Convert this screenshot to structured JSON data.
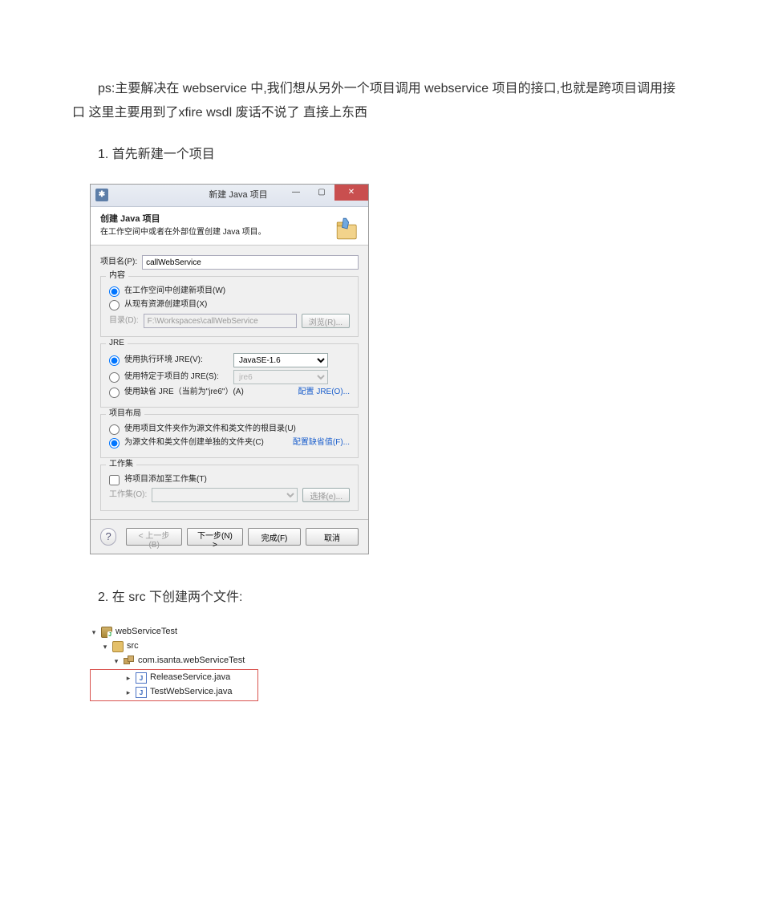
{
  "doc": {
    "para1": "ps:主要解决在 webservice 中,我们想从另外一个项目调用 webservice 项目的接口,也就是跨项目调用接口 这里主要用到了xfire wsdl 废话不说了 直接上东西",
    "step1": "1. 首先新建一个项目",
    "step2": "2. 在 src 下创建两个文件:"
  },
  "dialog": {
    "title": "新建 Java 项目",
    "banner_title": "创建 Java 项目",
    "banner_sub": "在工作空间中或者在外部位置创建 Java 项目。",
    "project_name_label": "项目名(P):",
    "project_name_value": "callWebService",
    "content": {
      "legend": "内容",
      "radio_in_workspace": "在工作空间中创建新项目(W)",
      "radio_from_existing": "从现有资源创建项目(X)",
      "dir_label": "目录(D):",
      "dir_value": "F:\\Workspaces\\callWebService",
      "browse_label": "浏览(R)..."
    },
    "jre": {
      "legend": "JRE",
      "radio_exec_env": "使用执行环境 JRE(V):",
      "exec_env_value": "JavaSE-1.6",
      "radio_project_specific": "使用特定于项目的 JRE(S):",
      "project_specific_value": "jre6",
      "radio_default": "使用缺省 JRE（当前为\"jre6\"）(A)",
      "config_link": "配置 JRE(O)..."
    },
    "layout": {
      "legend": "项目布局",
      "radio_project_root": "使用项目文件夹作为源文件和类文件的根目录(U)",
      "radio_separate": "为源文件和类文件创建单独的文件夹(C)",
      "config_link": "配置缺省值(F)..."
    },
    "workingset": {
      "legend": "工作集",
      "chk_add": "将项目添加至工作集(T)",
      "label_ws": "工作集(O):",
      "select_btn": "选择(e)..."
    },
    "buttons": {
      "back": "< 上一步(B)",
      "next": "下一步(N) >",
      "finish": "完成(F)",
      "cancel": "取消"
    }
  },
  "tree": {
    "project": "webServiceTest",
    "src": "src",
    "pkg": "com.isanta.webServiceTest",
    "files": [
      "ReleaseService.java",
      "TestWebService.java"
    ]
  }
}
